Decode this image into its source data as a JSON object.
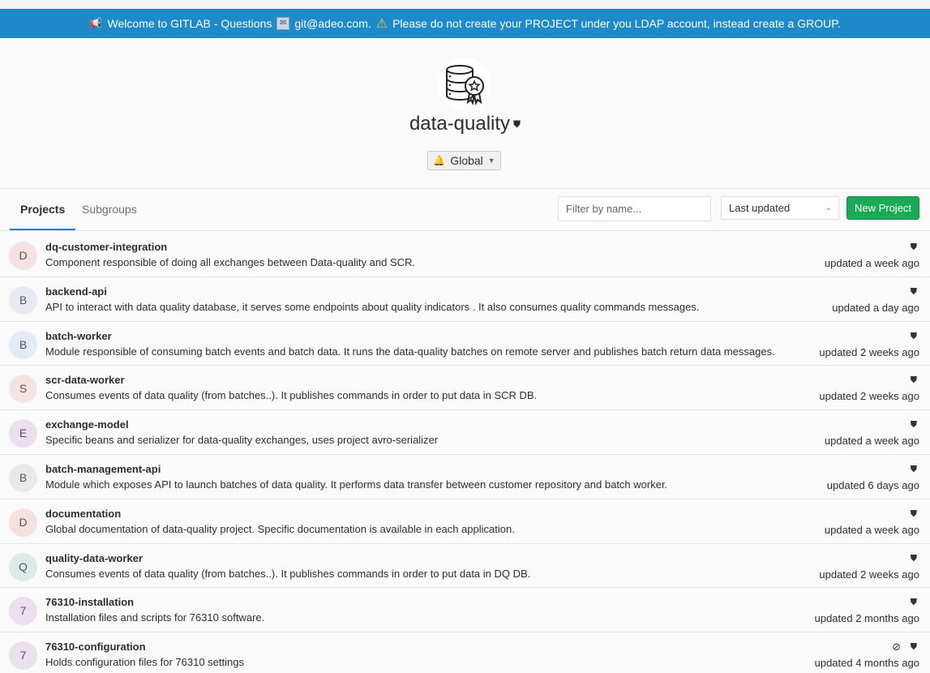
{
  "banner": {
    "megaphone_icon": "megaphone-icon",
    "text_1": "Welcome to GITLAB - Questions",
    "email": "git@adeo.com.",
    "text_2": "Please do not create your PROJECT under you LDAP account, instead create a GROUP.",
    "bg_color": "#1f8ac9"
  },
  "group": {
    "name": "data-quality",
    "visibility_icon": "shield-icon",
    "notification_label": "Global"
  },
  "tabs": [
    {
      "label": "Projects",
      "active": true
    },
    {
      "label": "Subgroups",
      "active": false
    }
  ],
  "filter": {
    "placeholder": "Filter by name..."
  },
  "sort": {
    "selected": "Last updated"
  },
  "new_project_label": "New Project",
  "projects": [
    {
      "initial": "D",
      "color": "#f5e1e1",
      "name": "dq-customer-integration",
      "description": "Component responsible of doing all exchanges between Data-quality and SCR.",
      "updated": "updated a week ago",
      "archived": false
    },
    {
      "initial": "B",
      "color": "#e7eaf1",
      "name": "backend-api",
      "description": "API to interact with data quality database, it serves some endpoints about quality indicators . It also consumes quality commands messages.",
      "updated": "updated a day ago",
      "archived": false
    },
    {
      "initial": "B",
      "color": "#e3ebf7",
      "name": "batch-worker",
      "description": "Module responsible of consuming batch events and batch data. It runs the data-quality batches on remote server and publishes batch return data messages.",
      "updated": "updated 2 weeks ago",
      "archived": false
    },
    {
      "initial": "S",
      "color": "#f5e4e4",
      "name": "scr-data-worker",
      "description": "Consumes events of data quality (from batches..). It publishes commands in order to put data in SCR DB.",
      "updated": "updated 2 weeks ago",
      "archived": false
    },
    {
      "initial": "E",
      "color": "#ecdff0",
      "name": "exchange-model",
      "description": "Specific beans and serializer for data-quality exchanges, uses project avro-serializer",
      "updated": "updated a week ago",
      "archived": false
    },
    {
      "initial": "B",
      "color": "#e9e9e9",
      "name": "batch-management-api",
      "description": "Module which exposes API to launch batches of data quality. It performs data transfer between customer repository and batch worker.",
      "updated": "updated 6 days ago",
      "archived": false
    },
    {
      "initial": "D",
      "color": "#f5e1e1",
      "name": "documentation",
      "description": "Global documentation of data-quality project. Specific documentation is available in each application.",
      "updated": "updated a week ago",
      "archived": false
    },
    {
      "initial": "Q",
      "color": "#dcebe9",
      "name": "quality-data-worker",
      "description": "Consumes events of data quality (from batches..). It publishes commands in order to put data in DQ DB.",
      "updated": "updated 2 weeks ago",
      "archived": false
    },
    {
      "initial": "7",
      "color": "#ecdff0",
      "name": "76310-installation",
      "description": "Installation files and scripts for 76310 software.",
      "updated": "updated 2 months ago",
      "archived": false
    },
    {
      "initial": "7",
      "color": "#ecdff0",
      "name": "76310-configuration",
      "description": "Holds configuration files for 76310 settings",
      "updated": "updated 4 months ago",
      "archived": true
    }
  ]
}
